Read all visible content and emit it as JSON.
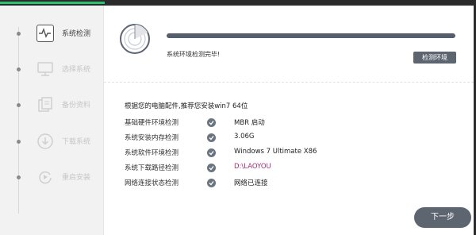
{
  "sidebar": {
    "items": [
      {
        "label": "系统检测",
        "icon": "pulse-monitor-icon",
        "active": true
      },
      {
        "label": "选择系统",
        "icon": "monitor-icon",
        "active": false
      },
      {
        "label": "备份资料",
        "icon": "document-icon",
        "active": false
      },
      {
        "label": "下载系统",
        "icon": "download-icon",
        "active": false
      },
      {
        "label": "重启安装",
        "icon": "restart-icon",
        "active": false
      }
    ]
  },
  "main": {
    "scan_icon": "radar-icon",
    "progress": 1.0,
    "status_text": "系统环境检测完毕!",
    "detect_button": "检测环境",
    "summary": "根据您的电脑配件,推荐您安装win7 64位",
    "checks": [
      {
        "label": "基础硬件环境检测",
        "value": "MBR 启动"
      },
      {
        "label": "系统安装内存检测",
        "value": "3.06G"
      },
      {
        "label": "系统软件环境检测",
        "value": "Windows 7 Ultimate X86"
      },
      {
        "label": "系统下载路径检测",
        "value": "D:\\LAOYOU"
      },
      {
        "label": "网络连接状态检测",
        "value": "网络已连接"
      }
    ],
    "next_button": "下一步"
  },
  "colors": {
    "accent": "#2fbf71",
    "button": "#5d6570",
    "check": "#6b7580",
    "path": "#a0307a"
  }
}
